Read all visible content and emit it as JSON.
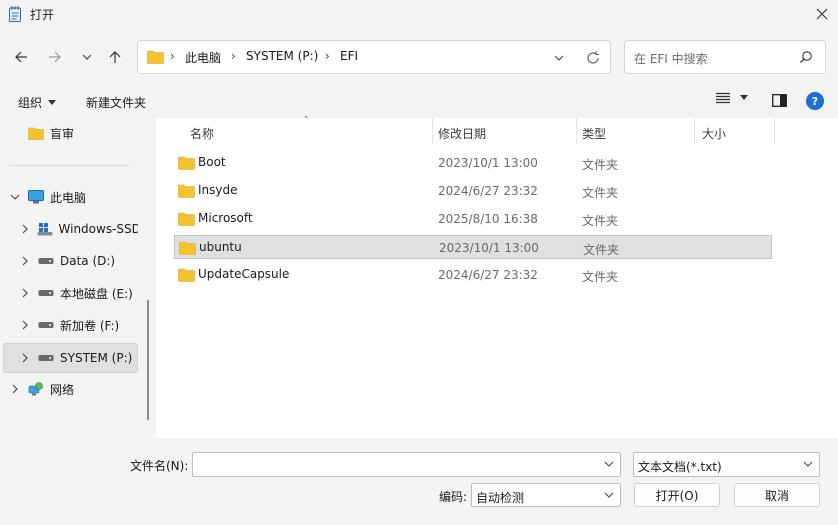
{
  "window": {
    "title": "打开"
  },
  "address": {
    "breadcrumbs": [
      "此电脑",
      "SYSTEM (P:)",
      "EFI"
    ]
  },
  "search": {
    "placeholder": "在 EFI 中搜索"
  },
  "toolbar": {
    "organize_label": "组织",
    "new_folder_label": "新建文件夹"
  },
  "nav": {
    "items": [
      {
        "label": "盲审",
        "icon": "folder-icon"
      },
      {
        "label": "此电脑",
        "icon": "pc-icon"
      },
      {
        "label": "Windows-SSD",
        "icon": "windows-drive-icon"
      },
      {
        "label": "Data (D:)",
        "icon": "drive-icon"
      },
      {
        "label": "本地磁盘 (E:)",
        "icon": "drive-icon"
      },
      {
        "label": "新加卷 (F:)",
        "icon": "drive-icon"
      },
      {
        "label": "SYSTEM (P:)",
        "icon": "drive-icon"
      },
      {
        "label": "网络",
        "icon": "network-icon"
      }
    ]
  },
  "columns": {
    "name": "名称",
    "modified": "修改日期",
    "type": "类型",
    "size": "大小"
  },
  "files": [
    {
      "name": "Boot",
      "modified": "2023/10/1 13:00",
      "type": "文件夹",
      "selected": false
    },
    {
      "name": "Insyde",
      "modified": "2024/6/27 23:32",
      "type": "文件夹",
      "selected": false
    },
    {
      "name": "Microsoft",
      "modified": "2025/8/10 16:38",
      "type": "文件夹",
      "selected": false
    },
    {
      "name": "ubuntu",
      "modified": "2023/10/1 13:00",
      "type": "文件夹",
      "selected": true
    },
    {
      "name": "UpdateCapsule",
      "modified": "2024/6/27 23:32",
      "type": "文件夹",
      "selected": false
    }
  ],
  "bottom": {
    "filename_label": "文件名(N):",
    "filename_value": "",
    "filetype_value": "文本文档(*.txt)",
    "encoding_label": "编码:",
    "encoding_value": "自动检测",
    "open_label": "打开(O)",
    "cancel_label": "取消"
  },
  "colors": {
    "folder": "#f4c430",
    "accent": "#1f6fd1",
    "selection": "#e0e0e0"
  }
}
